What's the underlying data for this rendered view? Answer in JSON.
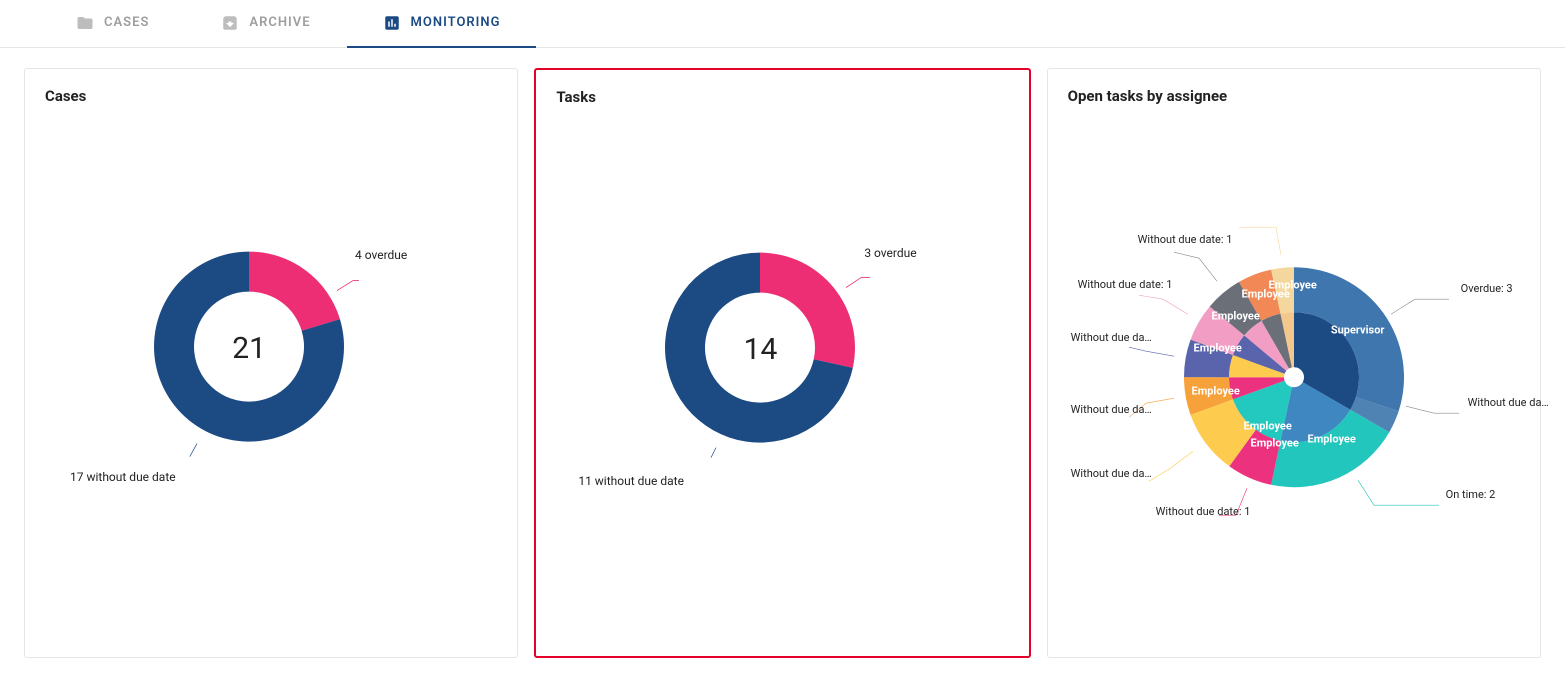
{
  "tabs": {
    "cases": {
      "label": "CASES"
    },
    "archive": {
      "label": "ARCHIVE"
    },
    "monitoring": {
      "label": "MONITORING"
    }
  },
  "panels": {
    "cases": {
      "title": "Cases",
      "center": "21",
      "label_overdue": "4 overdue",
      "label_without": "17 without due date"
    },
    "tasks": {
      "title": "Tasks",
      "center": "14",
      "label_overdue": "3 overdue",
      "label_without": "11 without due date"
    },
    "assignee": {
      "title": "Open tasks by assignee",
      "outer": {
        "overdue": "Overdue: 3",
        "without_da_1": "Without due da…",
        "ontime": "On time: 2",
        "without_1a": "Without due date: 1",
        "without_da_2": "Without due da…",
        "without_da_3": "Without due da…",
        "without_da_4": "Without due da…",
        "without_1b": "Without due date: 1",
        "without_1c": "Without due date: 1"
      },
      "inner": {
        "supervisor": "Supervisor",
        "employee": "Employee"
      }
    }
  },
  "chart_data": [
    {
      "type": "pie",
      "title": "Cases",
      "center_value": 21,
      "series": [
        {
          "name": "overdue",
          "value": 4,
          "color": "#e91e63"
        },
        {
          "name": "without due date",
          "value": 17,
          "color": "#1c4a83"
        }
      ]
    },
    {
      "type": "pie",
      "title": "Tasks",
      "center_value": 14,
      "series": [
        {
          "name": "overdue",
          "value": 3,
          "color": "#e91e63"
        },
        {
          "name": "without due date",
          "value": 11,
          "color": "#1c4a83"
        }
      ]
    },
    {
      "type": "pie",
      "title": "Open tasks by assignee",
      "note": "two-level sunburst: inner ring = assignee, outer ring = status per assignee",
      "inner_series": [
        {
          "name": "Supervisor",
          "value": 5,
          "color": "#1c4a83"
        },
        {
          "name": "Employee",
          "value": 2,
          "color": "#3c87b2"
        },
        {
          "name": "Employee",
          "value": 2,
          "color": "#22c6bd"
        },
        {
          "name": "Employee",
          "value": 1,
          "color": "#e91e63"
        },
        {
          "name": "Employee",
          "value": 1,
          "color": "#f9c64a"
        },
        {
          "name": "Employee",
          "value": 1,
          "color": "#6a5acd"
        },
        {
          "name": "Employee",
          "value": 1,
          "color": "#f29ec4"
        },
        {
          "name": "Employee",
          "value": 1,
          "color": "#6d7278"
        },
        {
          "name": "Employee",
          "value": 1,
          "color": "#f4a460"
        }
      ],
      "outer_series": [
        {
          "parent": "Supervisor",
          "name": "Overdue",
          "value": 3
        },
        {
          "parent": "Supervisor",
          "name": "Without due date",
          "value": 2
        },
        {
          "parent": "Employee",
          "name": "On time",
          "value": 2
        },
        {
          "parent": "Employee",
          "name": "Without due date",
          "value": 1
        },
        {
          "parent": "Employee",
          "name": "Without due date",
          "value": 1
        },
        {
          "parent": "Employee",
          "name": "Without due date",
          "value": 1
        },
        {
          "parent": "Employee",
          "name": "Without due date",
          "value": 1
        },
        {
          "parent": "Employee",
          "name": "Without due date",
          "value": 1
        },
        {
          "parent": "Employee",
          "name": "Without due date",
          "value": 1
        },
        {
          "parent": "Employee",
          "name": "Without due date",
          "value": 1
        }
      ]
    }
  ]
}
